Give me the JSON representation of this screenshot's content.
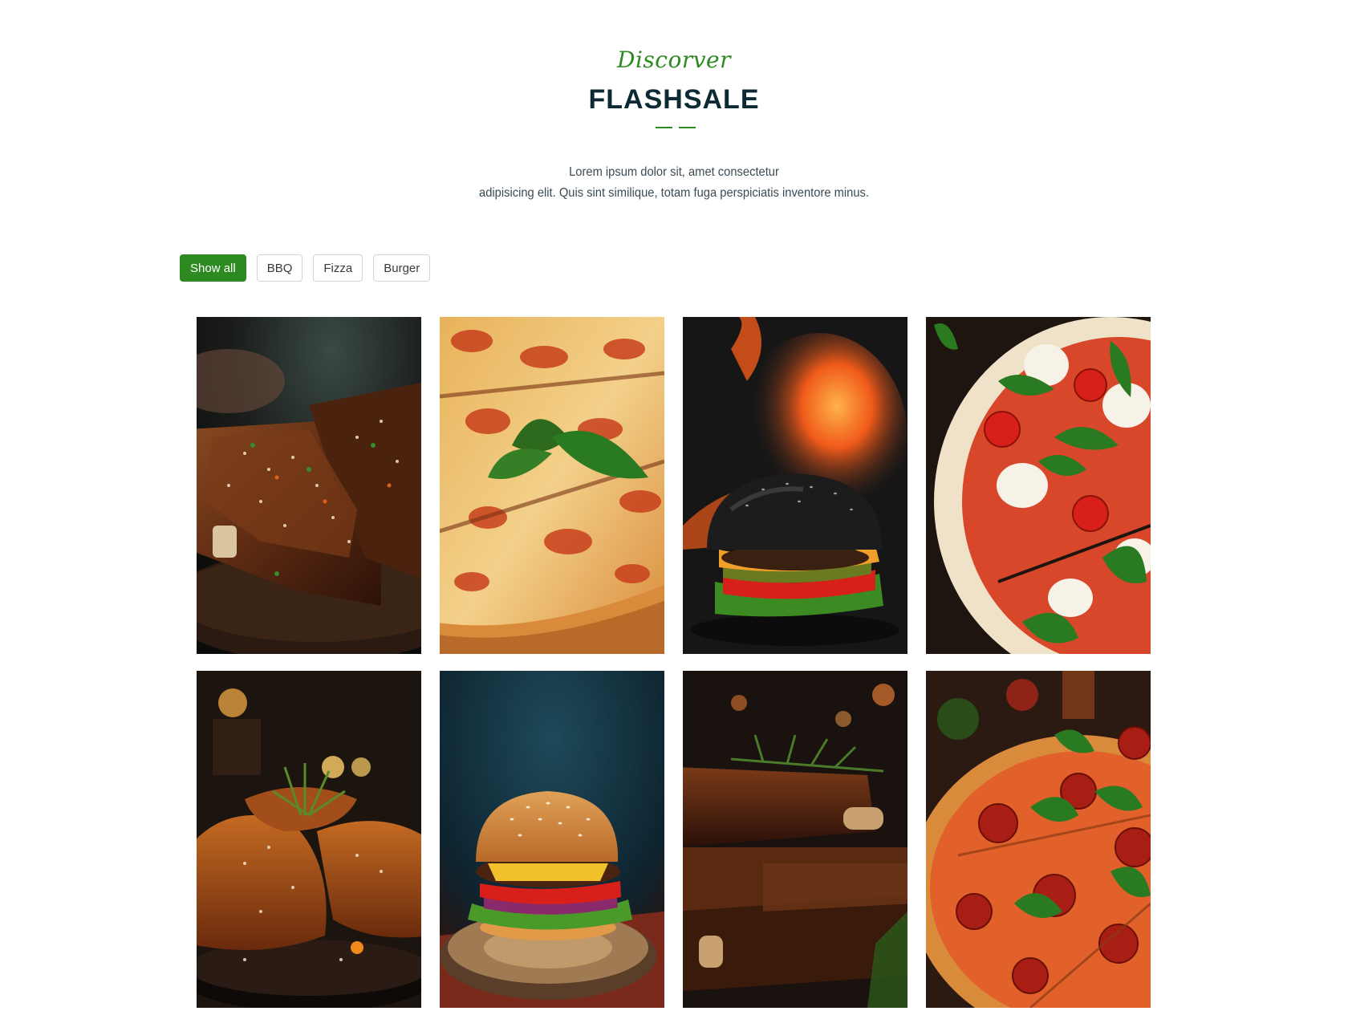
{
  "header": {
    "eyebrow": "Discorver",
    "title": "FLASHSALE",
    "description_line1": "Lorem ipsum dolor sit, amet consectetur",
    "description_line2": "adipisicing elit. Quis sint similique, totam fuga perspiciatis inventore minus."
  },
  "filters": [
    {
      "label": "Show all",
      "active": true
    },
    {
      "label": "BBQ",
      "active": false
    },
    {
      "label": "Fizza",
      "active": false
    },
    {
      "label": "Burger",
      "active": false
    }
  ],
  "gallery": [
    {
      "icon": "bbq-ribs-photo"
    },
    {
      "icon": "pizza-slices-photo"
    },
    {
      "icon": "black-burger-photo"
    },
    {
      "icon": "margherita-pizza-photo"
    },
    {
      "icon": "glazed-chicken-photo"
    },
    {
      "icon": "classic-burger-photo"
    },
    {
      "icon": "stacked-ribs-photo"
    },
    {
      "icon": "pepperoni-pizza-photo"
    }
  ],
  "colors": {
    "accent": "#2c8a21",
    "title": "#0c2a33",
    "text": "#3a4a54"
  }
}
